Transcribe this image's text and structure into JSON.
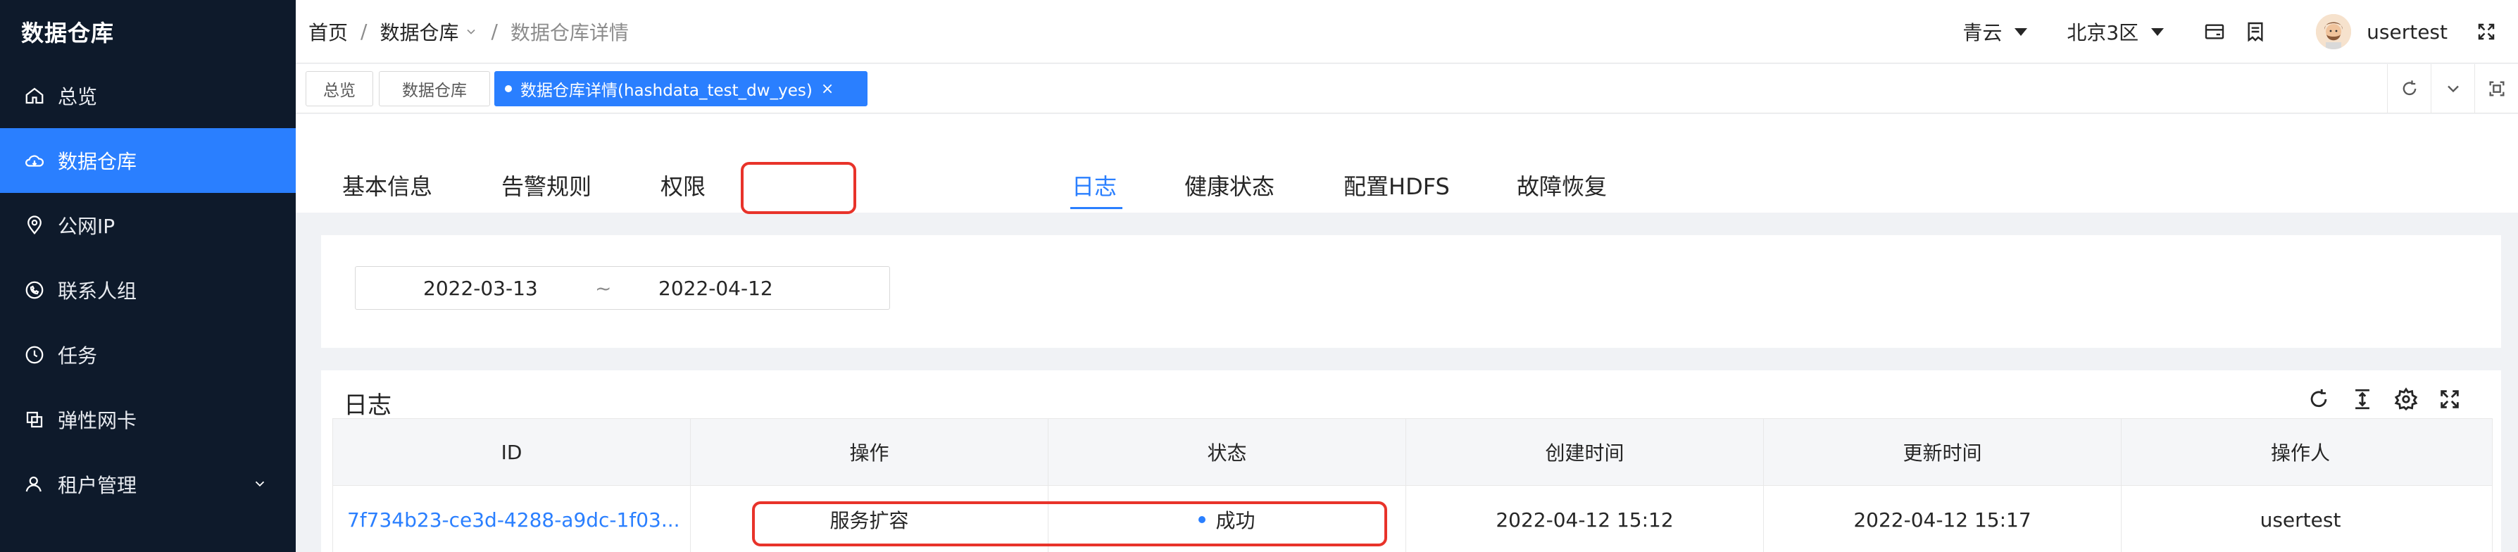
{
  "app": {
    "brand": "数据仓库"
  },
  "sidebar": {
    "items": [
      {
        "label": "总览",
        "icon": "home-icon"
      },
      {
        "label": "数据仓库",
        "icon": "cloud-icon",
        "active": true
      },
      {
        "label": "公网IP",
        "icon": "location-icon"
      },
      {
        "label": "联系人组",
        "icon": "contact-icon"
      },
      {
        "label": "任务",
        "icon": "clock-icon"
      },
      {
        "label": "弹性网卡",
        "icon": "nic-icon"
      },
      {
        "label": "租户管理",
        "icon": "user-icon",
        "expandable": true
      }
    ]
  },
  "header": {
    "breadcrumb": [
      "首页",
      "数据仓库",
      "数据仓库详情"
    ],
    "separator": "/",
    "cloud": "青云",
    "region": "北京3区",
    "username": "usertest"
  },
  "tabbar": {
    "tabs": [
      "总览",
      "数据仓库",
      "数据仓库详情(hashdata_test_dw_yes)"
    ],
    "close": "×"
  },
  "detail_tabs": [
    "基本信息",
    "告警规则",
    "权限",
    "日志",
    "健康状态",
    "配置HDFS",
    "故障恢复"
  ],
  "filter": {
    "start_date": "2022-03-13",
    "separator": "~",
    "end_date": "2022-04-12"
  },
  "log": {
    "title": "日志",
    "columns": [
      "ID",
      "操作",
      "状态",
      "创建时间",
      "更新时间",
      "操作人"
    ],
    "rows": [
      {
        "id": "7f734b23-ce3d-4288-a9dc-1f03...",
        "operation": "服务扩容",
        "status": "成功",
        "created": "2022-04-12 15:12",
        "updated": "2022-04-12 15:17",
        "operator": "usertest"
      }
    ]
  },
  "colors": {
    "primary": "#2a7fff",
    "sidebar": "#0e1a2b",
    "highlight": "#e8332a"
  }
}
